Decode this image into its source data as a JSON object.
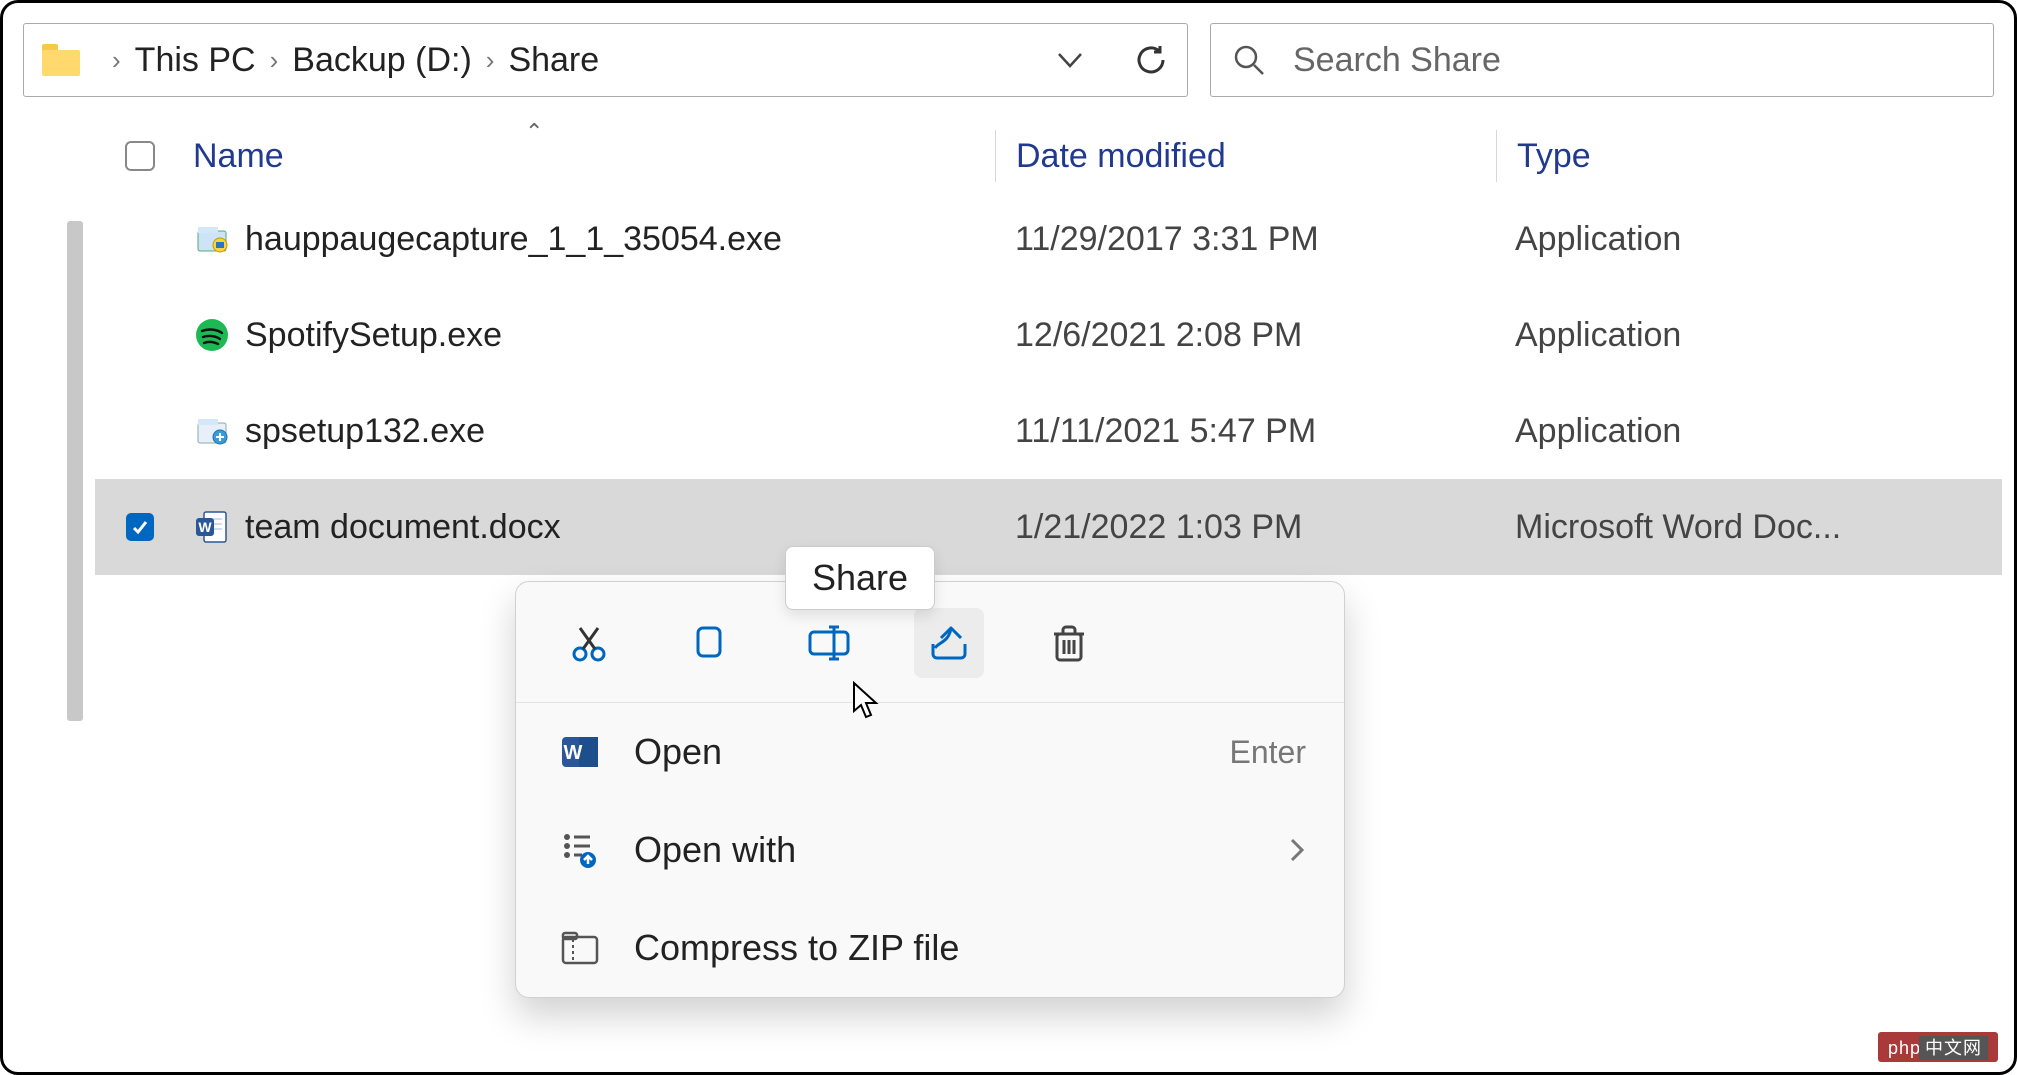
{
  "breadcrumb": {
    "items": [
      "This PC",
      "Backup (D:)",
      "Share"
    ]
  },
  "search": {
    "placeholder": "Search Share"
  },
  "columns": {
    "name": "Name",
    "date": "Date modified",
    "type": "Type"
  },
  "files": [
    {
      "name": "hauppaugecapture_1_1_35054.exe",
      "date": "11/29/2017 3:31 PM",
      "type": "Application",
      "icon": "installer",
      "selected": false
    },
    {
      "name": "SpotifySetup.exe",
      "date": "12/6/2021 2:08 PM",
      "type": "Application",
      "icon": "spotify",
      "selected": false
    },
    {
      "name": "spsetup132.exe",
      "date": "11/11/2021 5:47 PM",
      "type": "Application",
      "icon": "installer2",
      "selected": false
    },
    {
      "name": "team document.docx",
      "date": "1/21/2022 1:03 PM",
      "type": "Microsoft Word Doc...",
      "icon": "word",
      "selected": true
    }
  ],
  "tooltip": {
    "label": "Share"
  },
  "context_menu": {
    "icon_row": [
      {
        "name": "cut",
        "hover": false
      },
      {
        "name": "copy",
        "hover": false
      },
      {
        "name": "rename",
        "hover": false
      },
      {
        "name": "share",
        "hover": true
      },
      {
        "name": "delete",
        "hover": false
      }
    ],
    "items": [
      {
        "label": "Open",
        "accelerator": "Enter",
        "icon": "word-app",
        "submenu": false
      },
      {
        "label": "Open with",
        "accelerator": "",
        "icon": "open-with",
        "submenu": true
      },
      {
        "label": "Compress to ZIP file",
        "accelerator": "",
        "icon": "zip",
        "submenu": false
      }
    ]
  },
  "watermark": {
    "a": "php",
    "b": "中文网"
  }
}
